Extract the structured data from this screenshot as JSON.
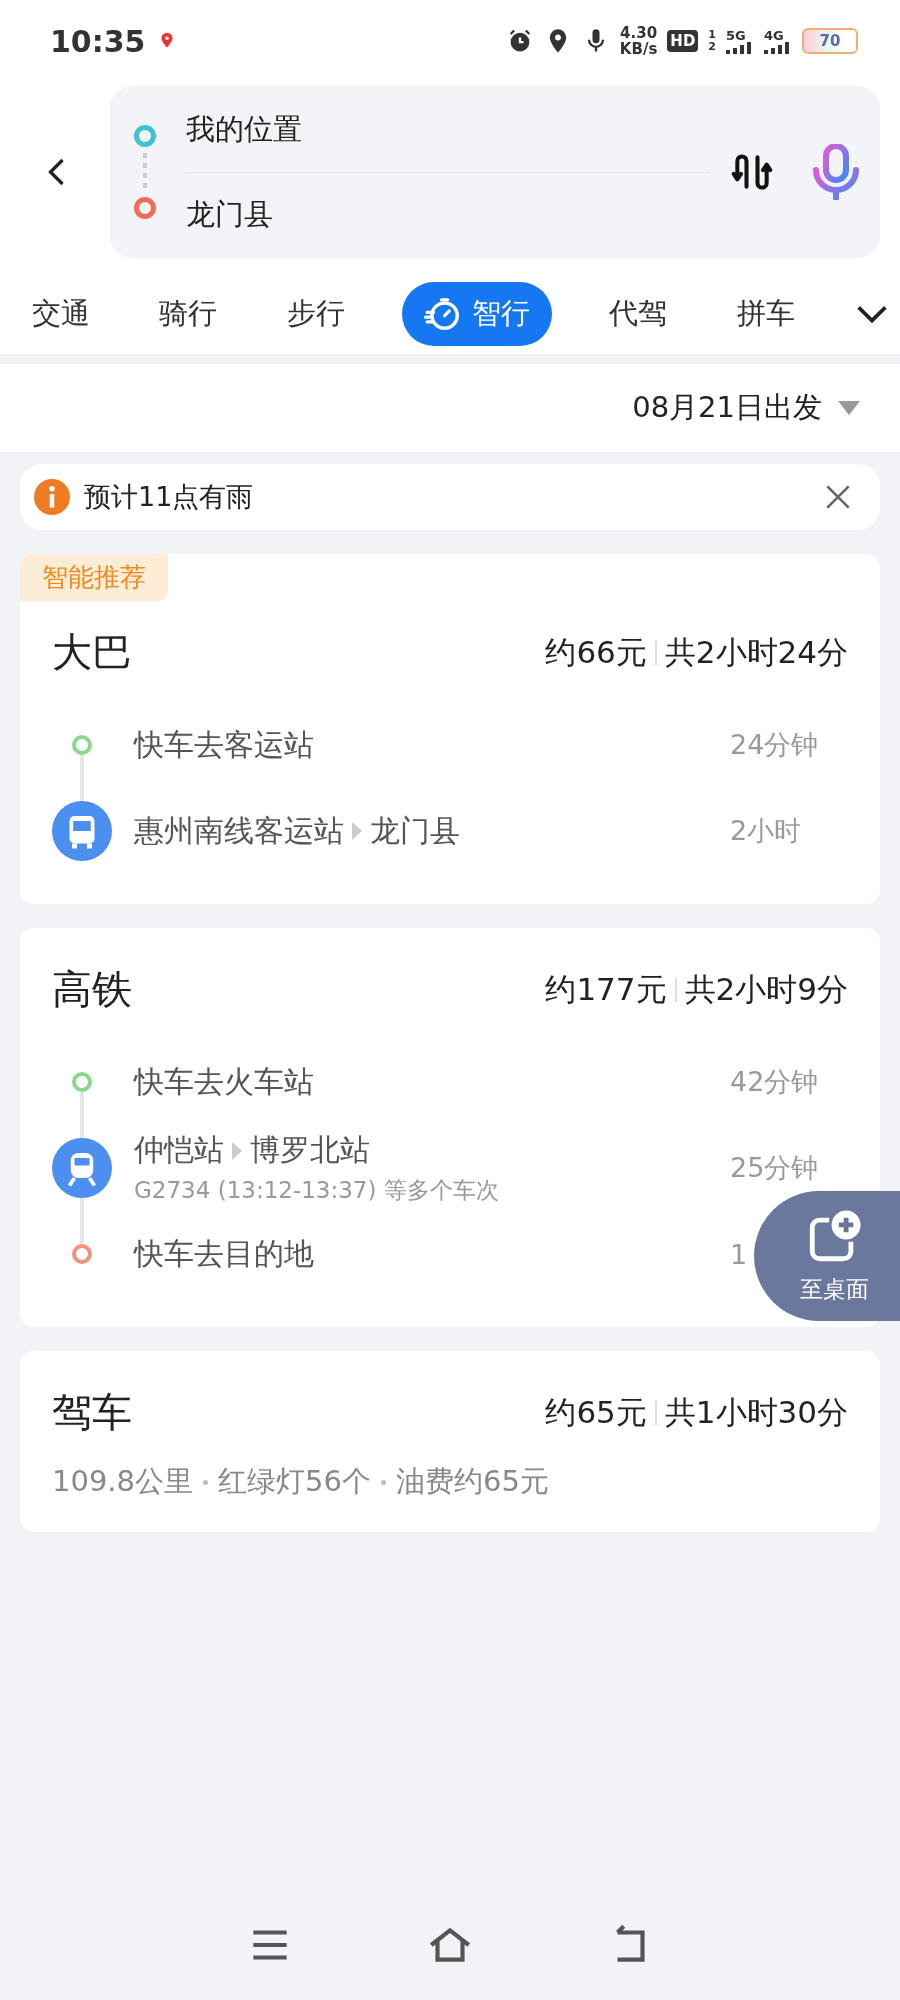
{
  "status_bar": {
    "time": "10:35",
    "speed": "4.30",
    "speed_unit": "KB/s",
    "hd": "HD",
    "sim": [
      "1",
      "2"
    ],
    "net": [
      "5G",
      "4G"
    ],
    "battery": "70"
  },
  "route": {
    "origin": "我的位置",
    "destination": "龙门县"
  },
  "tabs": [
    {
      "label": "交通",
      "selected": false
    },
    {
      "label": "骑行",
      "selected": false
    },
    {
      "label": "步行",
      "selected": false
    },
    {
      "label": "智行",
      "selected": true
    },
    {
      "label": "代驾",
      "selected": false
    },
    {
      "label": "拼车",
      "selected": false
    }
  ],
  "departure": "08月21日出发",
  "alert": "预计11点有雨",
  "plans": [
    {
      "badge": "智能推荐",
      "mode": "大巴",
      "price": "约66元",
      "duration": "共2小时24分",
      "steps": [
        {
          "kind": "start",
          "title": "快车去客运站",
          "time": "24分钟"
        },
        {
          "kind": "bus",
          "from": "惠州南线客运站",
          "to": "龙门县",
          "time": "2小时"
        }
      ]
    },
    {
      "mode": "高铁",
      "price": "约177元",
      "duration": "共2小时9分",
      "steps": [
        {
          "kind": "start",
          "title": "快车去火车站",
          "time": "42分钟"
        },
        {
          "kind": "train",
          "from": "仲恺站",
          "to": "博罗北站",
          "detail": "G2734 (13:12-13:37) 等多个车次",
          "time": "25分钟"
        },
        {
          "kind": "end",
          "title": "快车去目的地",
          "time": "1"
        }
      ]
    },
    {
      "mode": "驾车",
      "price": "约65元",
      "duration": "共1小时30分",
      "summary": [
        "109.8公里",
        "红绿灯56个",
        "油费约65元"
      ]
    }
  ],
  "float_button": "至桌面"
}
